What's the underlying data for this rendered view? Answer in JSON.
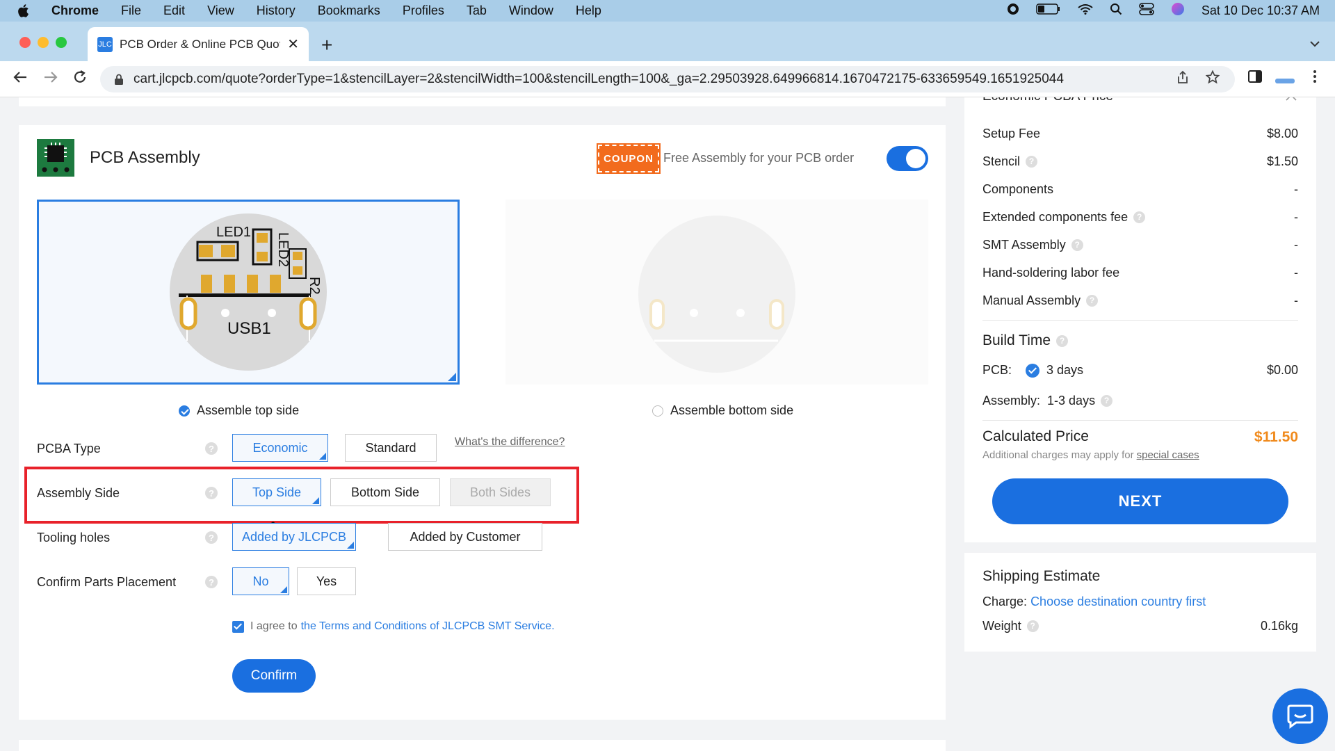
{
  "menubar": {
    "app": "Chrome",
    "items": [
      "File",
      "Edit",
      "View",
      "History",
      "Bookmarks",
      "Profiles",
      "Tab",
      "Window",
      "Help"
    ],
    "datetime": "Sat 10 Dec  10:37 AM"
  },
  "tab": {
    "favicon": "JLC",
    "title": "PCB Order & Online PCB Quote",
    "close": "✕",
    "new_tab": "+"
  },
  "toolbar": {
    "url": "cart.jlcpcb.com/quote?orderType=1&stencilLayer=2&stencilWidth=100&stencilLength=100&_ga=2.29503928.649966814.1670472175-633659549.1651925044"
  },
  "pcba": {
    "title": "PCB Assembly",
    "coupon_badge": "COUPON",
    "coupon_text": "Free Assembly for your PCB order",
    "toggle_on": true,
    "board_labels": {
      "led1": "LED1",
      "led2": "LED2",
      "r2": "R2",
      "usb1": "USB1"
    },
    "assemble_top": "Assemble top side",
    "assemble_bottom": "Assemble bottom side",
    "options": {
      "pcba_type": {
        "label": "PCBA Type",
        "economic": "Economic",
        "standard": "Standard",
        "diff_link": "What's the difference?"
      },
      "assembly_side": {
        "label": "Assembly Side",
        "top": "Top Side",
        "bottom": "Bottom Side",
        "both": "Both Sides"
      },
      "tooling_holes": {
        "label": "Tooling holes",
        "jlc": "Added by JLCPCB",
        "customer": "Added by Customer"
      },
      "confirm_parts": {
        "label": "Confirm Parts Placement",
        "no": "No",
        "yes": "Yes"
      }
    },
    "agree_prefix": "I agree to",
    "agree_link": "the Terms and Conditions of JLCPCB SMT Service.",
    "confirm": "Confirm"
  },
  "price": {
    "section_title": "Economic PCBA Price",
    "rows": [
      {
        "label": "Setup Fee",
        "value": "$8.00",
        "help": false
      },
      {
        "label": "Stencil",
        "value": "$1.50",
        "help": true
      },
      {
        "label": "Components",
        "value": "-",
        "help": false
      },
      {
        "label": "Extended components fee",
        "value": "-",
        "help": true
      },
      {
        "label": "SMT Assembly",
        "value": "-",
        "help": true
      },
      {
        "label": "Hand-soldering labor fee",
        "value": "-",
        "help": false
      },
      {
        "label": "Manual Assembly",
        "value": "-",
        "help": true
      }
    ],
    "build_time": "Build Time",
    "pcb_label": "PCB:",
    "pcb_days": "3 days",
    "pcb_value": "$0.00",
    "assembly_label": "Assembly:",
    "assembly_days": "1-3 days",
    "calc_label": "Calculated Price",
    "calc_value": "$11.50",
    "calc_note": "Additional charges may apply for",
    "calc_note_link": "special cases",
    "next": "NEXT"
  },
  "shipping": {
    "title": "Shipping Estimate",
    "charge_label": "Charge:",
    "charge_link": "Choose destination country first",
    "weight_label": "Weight",
    "weight_value": "0.16kg"
  },
  "colors": {
    "accent": "#1a6fe0",
    "highlight": "#e8212a",
    "price": "#f08a1c",
    "coupon": "#f26b1d"
  }
}
